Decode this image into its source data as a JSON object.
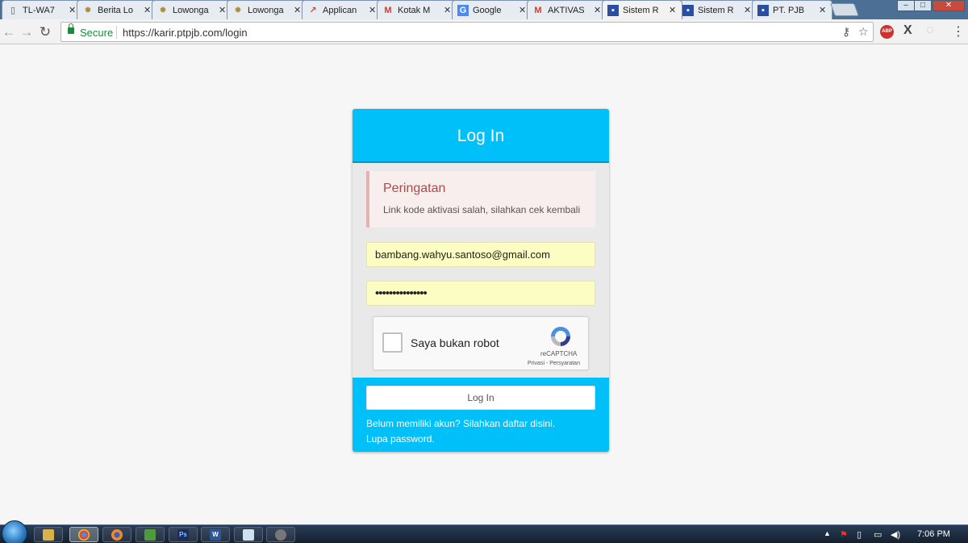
{
  "browser": {
    "tabs": [
      {
        "label": "TL-WA7",
        "icon": "page-icon"
      },
      {
        "label": "Berita Lo",
        "icon": "garuda-icon"
      },
      {
        "label": "Lowonga",
        "icon": "garuda-icon"
      },
      {
        "label": "Lowonga",
        "icon": "garuda-icon"
      },
      {
        "label": "Applican",
        "icon": "app-icon"
      },
      {
        "label": "Kotak M",
        "icon": "gmail-icon"
      },
      {
        "label": "Google",
        "icon": "google-icon"
      },
      {
        "label": "AKTIVAS",
        "icon": "gmail-icon"
      },
      {
        "label": "Sistem R",
        "icon": "pjb-icon"
      },
      {
        "label": "Sistem R",
        "icon": "pjb-icon"
      },
      {
        "label": "PT. PJB",
        "icon": "pjb-icon"
      }
    ],
    "address": {
      "secure_label": "Secure",
      "url": "https://karir.ptpjb.com/login"
    },
    "extension_abp": "ABP"
  },
  "login": {
    "title": "Log In",
    "alert": {
      "title": "Peringatan",
      "message": "Link kode aktivasi salah, silahkan cek kembali"
    },
    "email_value": "bambang.wahyu.santoso@gmail.com",
    "password_value": "•••••••••••••••",
    "captcha": {
      "label": "Saya bukan robot",
      "brand": "reCAPTCHA",
      "links": "Privasi - Persyaratan"
    },
    "submit_label": "Log In",
    "register_link": "Belum memiliki akun? Silahkan daftar disini.",
    "forgot_link": "Lupa password."
  },
  "taskbar": {
    "clock": "7:06 PM",
    "word_label": "W",
    "photoshop_label": "Ps"
  },
  "colors": {
    "accent": "#00c0fa",
    "alert_text": "#b04848",
    "autofill": "#fbfdc2"
  }
}
